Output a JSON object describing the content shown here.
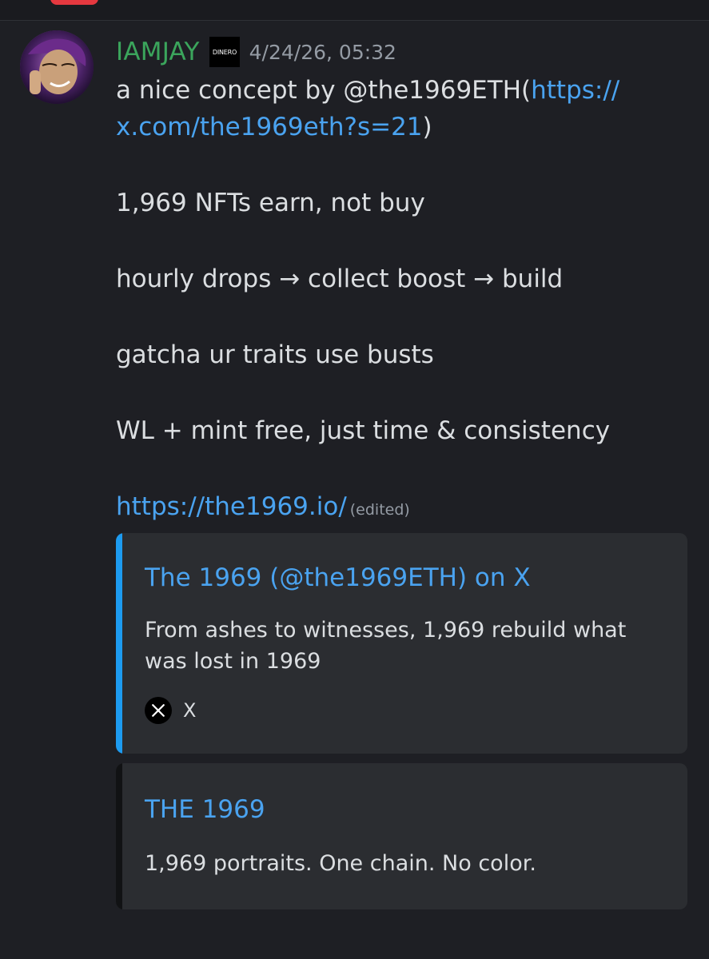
{
  "message": {
    "username": "IAMJAY",
    "role_badge_text": "DINERO",
    "timestamp": "4/24/26, 05:32",
    "line1_text": "a nice concept by @the1969ETH(",
    "line1_link": "https://x.com/the1969eth?s=21",
    "line1_close": ")",
    "link_part1": "https://",
    "link_part2": "x.com/the1969eth?s=21",
    "paragraph2": "1,969 NFTs earn, not buy",
    "paragraph3": "hourly drops → collect boost → build",
    "paragraph4": "gatcha ur traits use busts",
    "paragraph5": "WL + mint free, just time & consistency",
    "final_link": "https://the1969.io/",
    "edited_label": "(edited)"
  },
  "embeds": [
    {
      "title": "The 1969 (@the1969ETH) on X",
      "description": "From ashes to witnesses, 1,969 rebuild what was lost in 1969",
      "footer_label": "X",
      "footer_icon": "x-logo-icon",
      "accent_color": "#1d9bf0"
    },
    {
      "title": "THE 1969",
      "description": "1,969 portraits. One chain. No color.",
      "accent_color": "#111214"
    }
  ]
}
